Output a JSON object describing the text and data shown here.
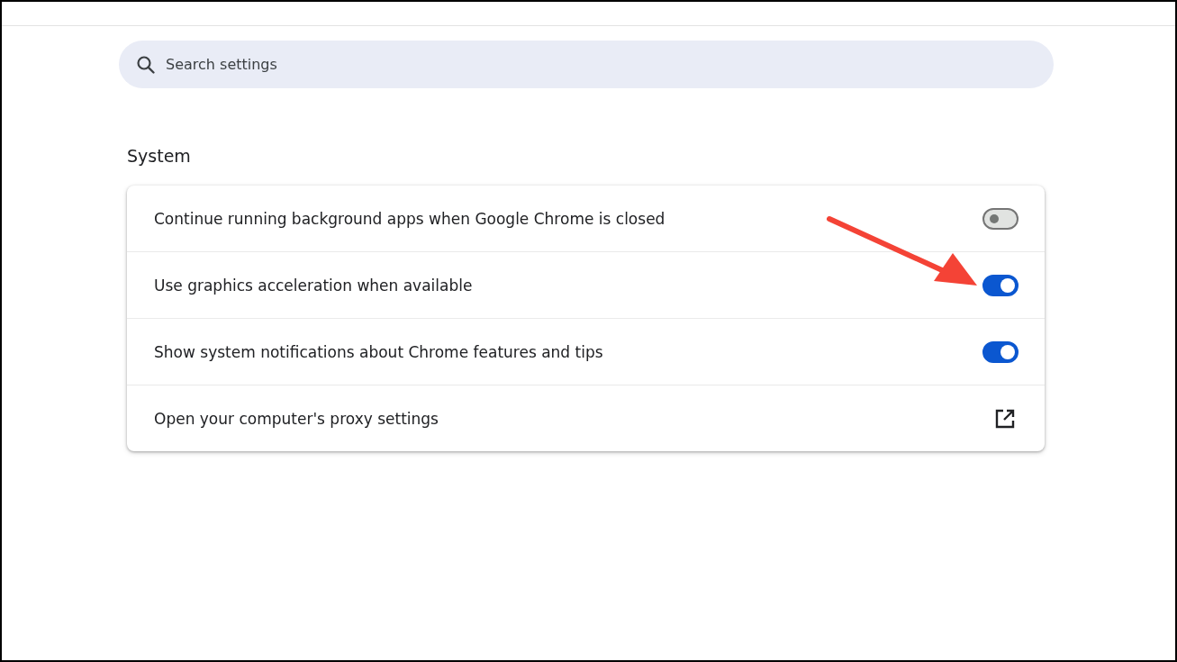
{
  "search": {
    "placeholder": "Search settings"
  },
  "section": {
    "title": "System"
  },
  "rows": [
    {
      "kind": "toggle",
      "label": "Continue running background apps when Google Chrome is closed",
      "on": false
    },
    {
      "kind": "toggle",
      "label": "Use graphics acceleration when available",
      "on": true
    },
    {
      "kind": "toggle",
      "label": "Show system notifications about Chrome features and tips",
      "on": true
    },
    {
      "kind": "link",
      "label": "Open your computer's proxy settings"
    }
  ]
}
